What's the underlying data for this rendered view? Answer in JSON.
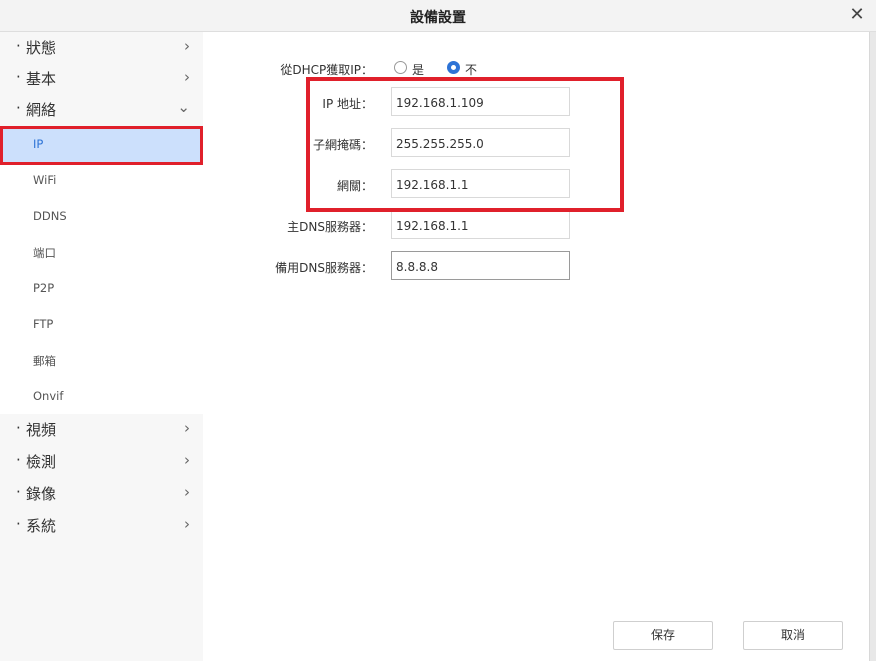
{
  "window": {
    "title": "設備設置"
  },
  "sidebar": {
    "categories_top": [
      {
        "label": "狀態",
        "expanded": false
      },
      {
        "label": "基本",
        "expanded": false
      },
      {
        "label": "網絡",
        "expanded": true
      }
    ],
    "network_items": [
      {
        "label": "IP",
        "active": true
      },
      {
        "label": "WiFi"
      },
      {
        "label": "DDNS"
      },
      {
        "label": "端口"
      },
      {
        "label": "P2P"
      },
      {
        "label": "FTP"
      },
      {
        "label": "郵箱"
      },
      {
        "label": "Onvif"
      }
    ],
    "categories_bottom": [
      {
        "label": "視頻"
      },
      {
        "label": "檢測"
      },
      {
        "label": "錄像"
      },
      {
        "label": "系統"
      }
    ]
  },
  "form": {
    "dhcp": {
      "label": "從DHCP獲取IP：",
      "option_yes": "是",
      "option_no": "不",
      "selected": "不"
    },
    "ip": {
      "label": "IP 地址：",
      "value": "192.168.1.109"
    },
    "subnet": {
      "label": "子網掩碼：",
      "value": "255.255.255.0"
    },
    "gateway": {
      "label": "網關：",
      "value": "192.168.1.1"
    },
    "dns1": {
      "label": "主DNS服務器：",
      "value": "192.168.1.1"
    },
    "dns2": {
      "label": "備用DNS服務器：",
      "value": "8.8.8.8"
    }
  },
  "buttons": {
    "save": "保存",
    "cancel": "取消"
  },
  "colors": {
    "highlight": "#e0202b",
    "accent": "#2d73d6",
    "active_bg": "#cce0fc"
  }
}
